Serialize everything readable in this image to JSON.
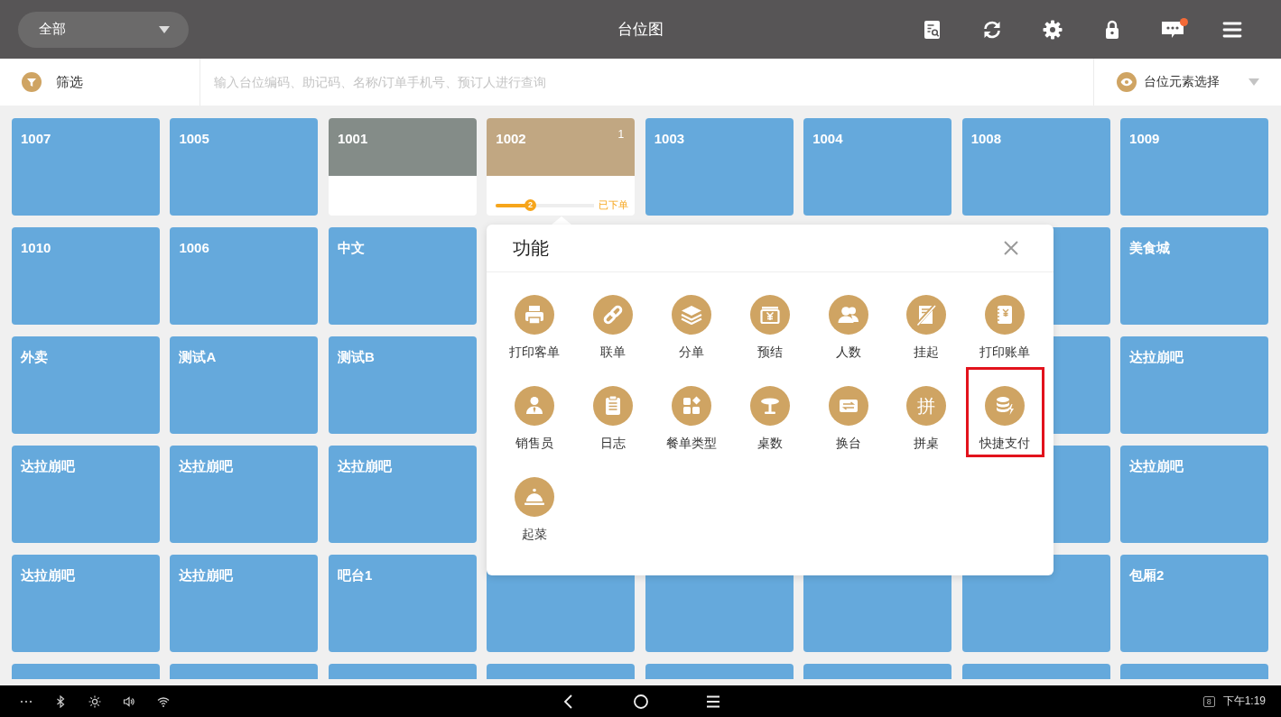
{
  "header": {
    "area_dropdown": {
      "value": "全部"
    },
    "title": "台位图",
    "toolbar": {
      "unread_dot": true
    }
  },
  "filter_bar": {
    "filter_label": "筛选",
    "search": {
      "placeholder": "输入台位编码、助记码、名称/订单手机号、预订人进行查询"
    },
    "element_select": {
      "label": "台位元素选择"
    }
  },
  "table_grid": {
    "tables": [
      {
        "label": "1007",
        "kind": "free"
      },
      {
        "label": "1005",
        "kind": "free"
      },
      {
        "label": "1001",
        "kind": "opened"
      },
      {
        "label": "1002",
        "kind": "ordered",
        "count": "1",
        "progress": {
          "level": 0.35,
          "step": "2",
          "label": "已下单"
        }
      },
      {
        "label": "1003",
        "kind": "free"
      },
      {
        "label": "1004",
        "kind": "free"
      },
      {
        "label": "1008",
        "kind": "free"
      },
      {
        "label": "1009",
        "kind": "free"
      },
      {
        "label": "1010",
        "kind": "free"
      },
      {
        "label": "1006",
        "kind": "free"
      },
      {
        "label": "中文",
        "kind": "free"
      },
      {
        "kind": "free"
      },
      {
        "label": "美食城",
        "kind": "free"
      },
      {
        "label": "外卖",
        "kind": "free"
      },
      {
        "label": "测试A",
        "kind": "free"
      },
      {
        "label": "测试B",
        "kind": "free"
      },
      {
        "kind": "free"
      },
      {
        "label": "达拉崩吧",
        "kind": "free"
      },
      {
        "label": "达拉崩吧",
        "kind": "free"
      },
      {
        "label": "达拉崩吧",
        "kind": "free"
      },
      {
        "label": "达拉崩吧",
        "kind": "free"
      },
      {
        "kind": "free"
      },
      {
        "label": "达拉崩吧",
        "kind": "free"
      },
      {
        "label": "达拉崩吧",
        "kind": "free"
      },
      {
        "label": "达拉崩吧",
        "kind": "free"
      },
      {
        "label": "吧台1",
        "kind": "free"
      },
      {
        "kind": "free"
      },
      {
        "kind": "free"
      },
      {
        "kind": "free"
      },
      {
        "kind": "free"
      },
      {
        "label": "包厢2",
        "kind": "free"
      },
      {
        "kind": "free"
      },
      {
        "kind": "free"
      },
      {
        "kind": "free"
      },
      {
        "kind": "free"
      },
      {
        "kind": "free"
      },
      {
        "kind": "free"
      },
      {
        "kind": "free"
      },
      {
        "kind": "free"
      }
    ]
  },
  "function_popup": {
    "title": "功能",
    "items": [
      {
        "label": "打印客单",
        "highlighted": false
      },
      {
        "label": "联单",
        "highlighted": false
      },
      {
        "label": "分单",
        "highlighted": false
      },
      {
        "label": "预结",
        "highlighted": false
      },
      {
        "label": "人数",
        "highlighted": false
      },
      {
        "label": "挂起",
        "highlighted": false
      },
      {
        "label": "打印账单",
        "highlighted": false
      },
      {
        "label": "销售员",
        "highlighted": false
      },
      {
        "label": "日志",
        "highlighted": false
      },
      {
        "label": "餐单类型",
        "highlighted": false
      },
      {
        "label": "桌数",
        "highlighted": false
      },
      {
        "label": "换台",
        "highlighted": false
      },
      {
        "label": "拼桌",
        "glyph": "拼",
        "highlighted": false
      },
      {
        "label": "快捷支付",
        "highlighted": true
      },
      {
        "label": "起菜",
        "highlighted": false
      }
    ]
  },
  "status_bar": {
    "notification_count": "8",
    "time": "下午1:19"
  }
}
